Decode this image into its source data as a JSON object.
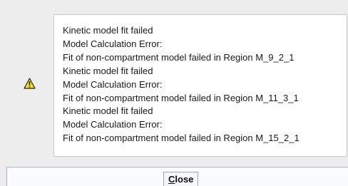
{
  "dialog": {
    "icon": "warning-icon",
    "messages": [
      "Kinetic model fit failed",
      "Model Calculation Error:",
      "Fit of non-compartment model failed in Region M_9_2_1",
      "Kinetic model fit failed",
      "Model Calculation Error:",
      "Fit of non-compartment model failed in Region M_11_3_1",
      "Kinetic model fit failed",
      "Model Calculation Error:",
      "Fit of non-compartment model failed in Region M_15_2_1"
    ],
    "close_button": {
      "mnemonic": "C",
      "rest": "lose"
    }
  },
  "colors": {
    "background": "#ededed",
    "message_background": "#ffffff",
    "warning_fill": "#f5e41c",
    "warning_outline": "#222222"
  }
}
